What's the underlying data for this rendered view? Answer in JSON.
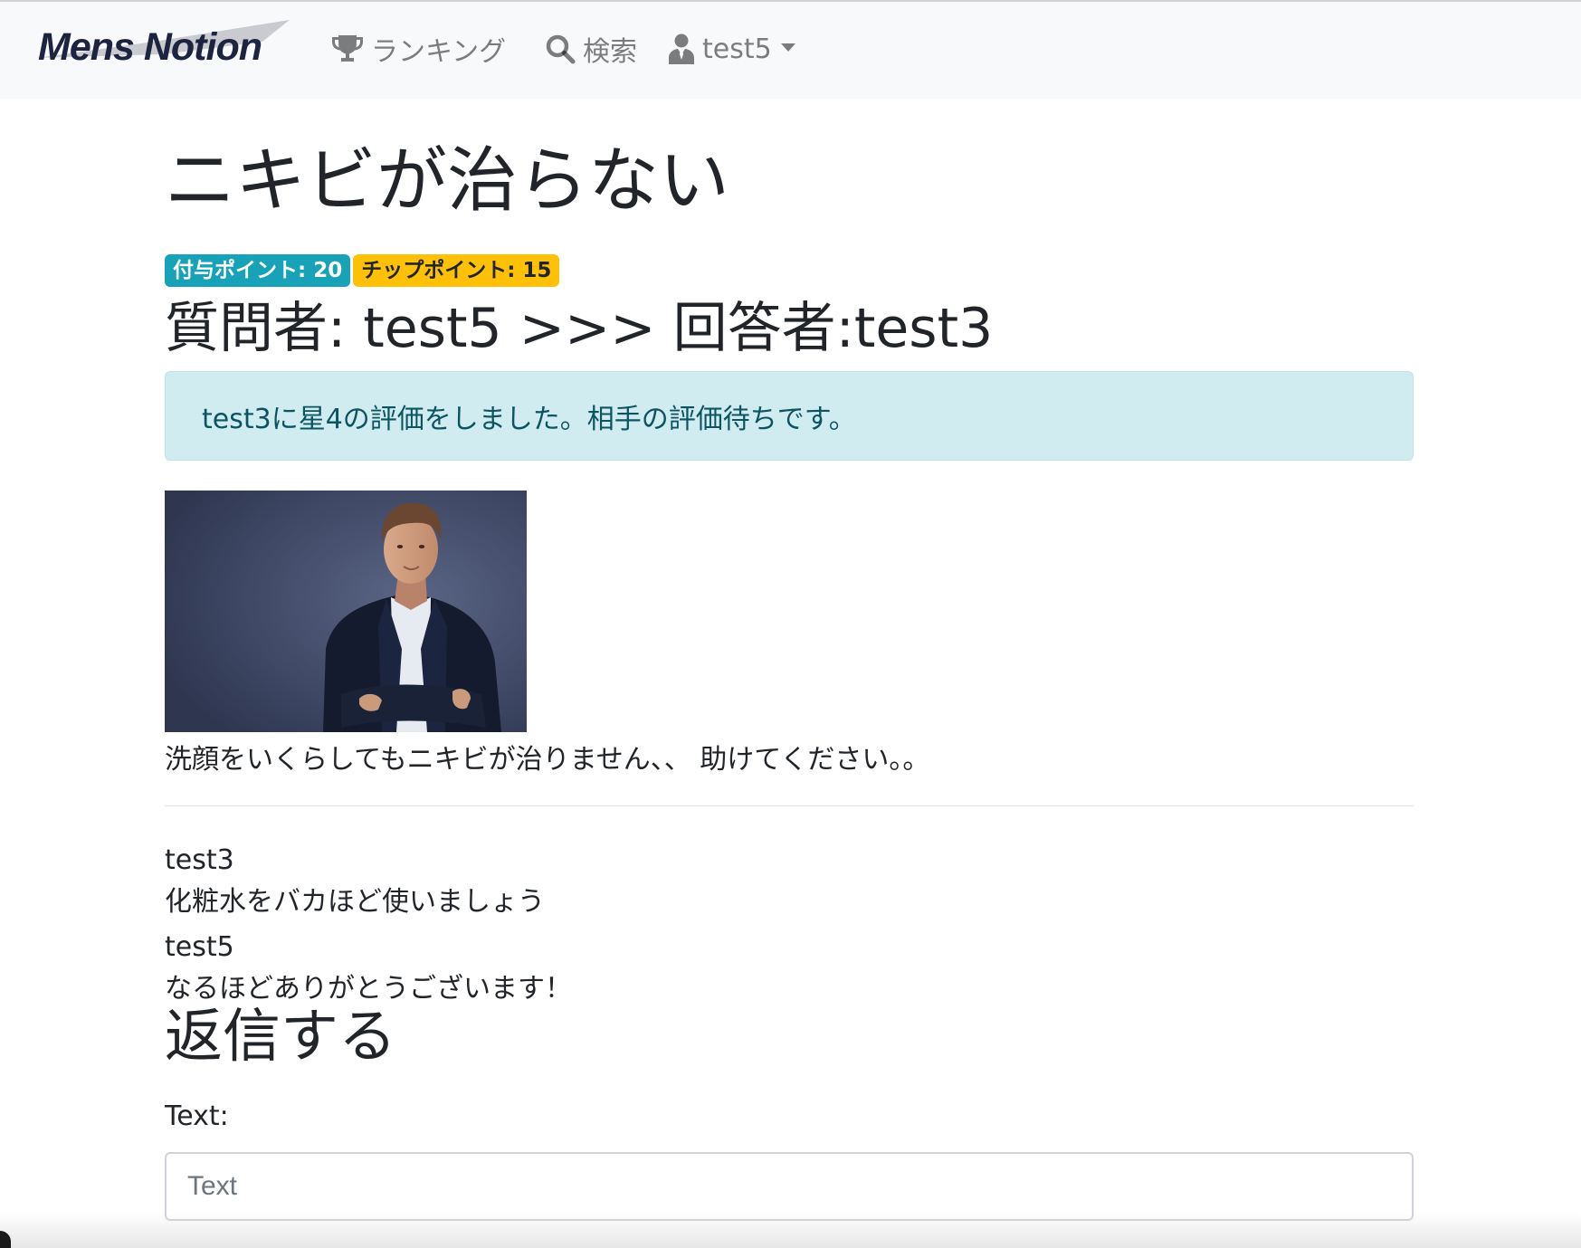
{
  "navbar": {
    "brand": "Mens Notion",
    "links": [
      {
        "label": "ランキング",
        "icon": "trophy-icon"
      },
      {
        "label": "検索",
        "icon": "search-icon"
      },
      {
        "label": "test5",
        "icon": "user-icon"
      }
    ]
  },
  "question": {
    "title": "ニキビが治らない",
    "badges": {
      "award_points": "付与ポイント: 20",
      "tip_points": "チップポイント: 15"
    },
    "participants": "質問者: test5 >>> 回答者:test3",
    "alert": "test3に星4の評価をしました。相手の評価待ちです。",
    "body": "洗顔をいくらしてもニキビが治りません、、 助けてください。。"
  },
  "replies": [
    {
      "author": "test3",
      "text": "化粧水をバカほど使いましょう"
    },
    {
      "author": "test5",
      "text": "なるほどありがとうございます！"
    }
  ],
  "reply_form": {
    "heading": "返信する",
    "label": "Text:",
    "placeholder": "Text"
  },
  "colors": {
    "badge_info": "#17a2b8",
    "badge_warning": "#ffc107",
    "alert_bg": "#d1ecf1",
    "alert_text": "#0c5460",
    "navbar_bg": "#f8f9fa"
  }
}
